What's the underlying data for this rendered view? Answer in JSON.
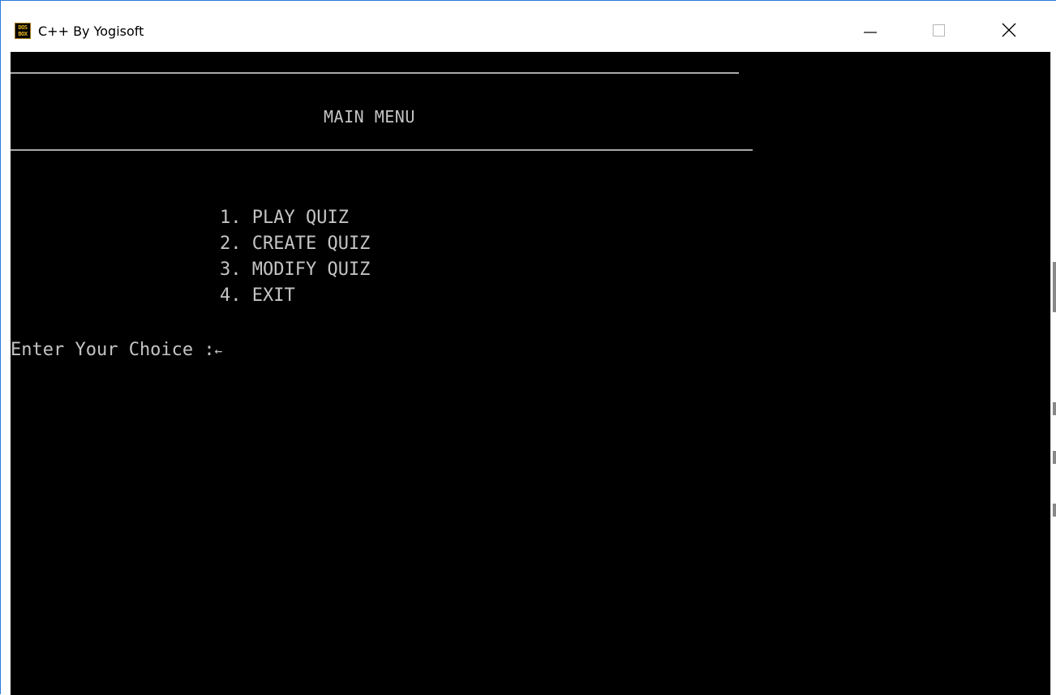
{
  "window": {
    "title": "C++ By Yogisoft",
    "icon": {
      "name": "dosbox-icon",
      "line1": "DOS",
      "line2": "BOX"
    },
    "controls": {
      "minimize": "minimize-icon",
      "maximize": "maximize-icon",
      "close": "close-icon"
    }
  },
  "console": {
    "heading": "MAIN MENU",
    "menu_items": [
      {
        "label": "1. PLAY QUIZ"
      },
      {
        "label": "2. CREATE QUIZ"
      },
      {
        "label": "3. MODIFY QUIZ"
      },
      {
        "label": "4. EXIT"
      }
    ],
    "prompt": "Enter Your Choice :",
    "cursor_glyph": "←"
  },
  "colors": {
    "console_background": "#000000",
    "console_text": "#c4c4c4",
    "title_bar": "#ffffff",
    "icon_accent": "#e8b81c"
  }
}
